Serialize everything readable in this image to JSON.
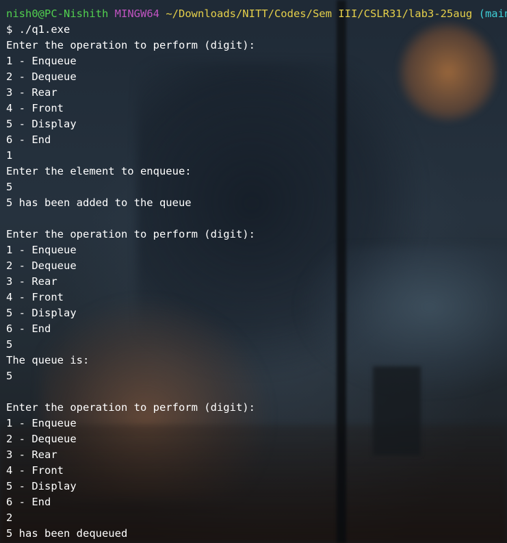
{
  "prompt": {
    "user_host": "nish0@PC-Nishith",
    "system": "MINGW64",
    "path": "~/Downloads/NITT/Codes/Sem III/CSLR31/lab3-25aug",
    "branch": "(main)"
  },
  "command": "$ ./q1.exe",
  "output_lines": [
    "Enter the operation to perform (digit):",
    "1 - Enqueue",
    "2 - Dequeue",
    "3 - Rear",
    "4 - Front",
    "5 - Display",
    "6 - End",
    "1",
    "Enter the element to enqueue:",
    "5",
    "5 has been added to the queue",
    "",
    "Enter the operation to perform (digit):",
    "1 - Enqueue",
    "2 - Dequeue",
    "3 - Rear",
    "4 - Front",
    "5 - Display",
    "6 - End",
    "5",
    "The queue is:",
    "5",
    "",
    "Enter the operation to perform (digit):",
    "1 - Enqueue",
    "2 - Dequeue",
    "3 - Rear",
    "4 - Front",
    "5 - Display",
    "6 - End",
    "2",
    "5 has been dequeued"
  ],
  "colors": {
    "user_host": "#52d04f",
    "system": "#c154c1",
    "path": "#e6d04a",
    "branch": "#3fd0d8",
    "text": "#ffffff"
  }
}
